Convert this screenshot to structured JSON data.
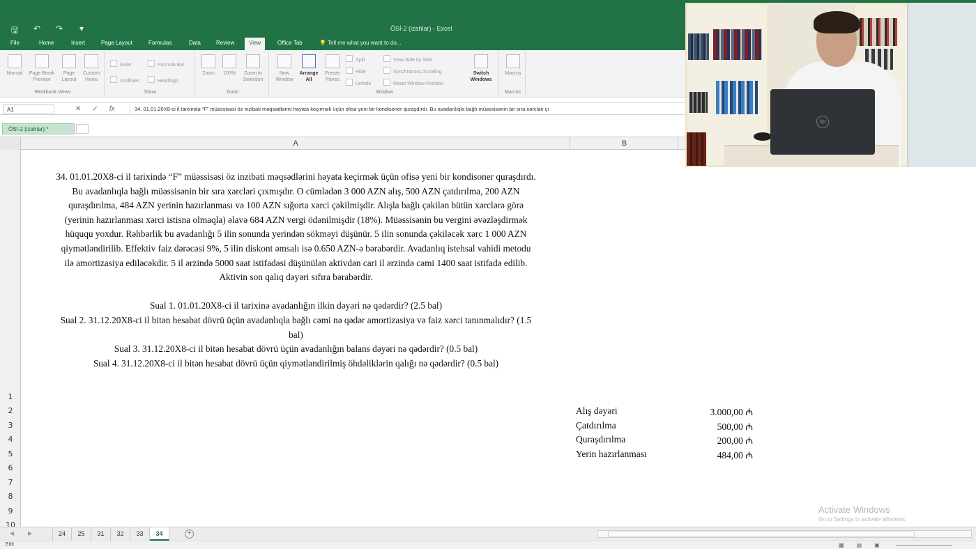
{
  "window": {
    "title": "ÖSİ-2 (izahlar) - Excel",
    "qat": [
      "save",
      "undo",
      "redo",
      "customize"
    ]
  },
  "menu": {
    "items": [
      "File",
      "Home",
      "Insert",
      "Page Layout",
      "Formulas",
      "Data",
      "Review",
      "View",
      "Office Tab"
    ],
    "active": "View",
    "tell_me": "Tell me what you want to do..."
  },
  "ribbon": {
    "workbook_views": {
      "label": "Workbook Views",
      "normal": "Normal",
      "page_break": "Page Break Preview",
      "page_layout": "Page Layout",
      "custom_views": "Custom Views"
    },
    "show": {
      "label": "Show",
      "ruler": "Ruler",
      "formula_bar": "Formula Bar",
      "gridlines": "Gridlines",
      "headings": "Headings"
    },
    "zoom": {
      "label": "Zoom",
      "zoom": "Zoom",
      "hundred": "100%",
      "zoom_sel": "Zoom to Selection"
    },
    "window": {
      "label": "Window",
      "new_window": "New Window",
      "arrange_all": "Arrange All",
      "freeze": "Freeze Panes",
      "split": "Split",
      "hide": "Hide",
      "unhide": "Unhide",
      "side_by_side": "View Side by Side",
      "sync_scroll": "Synchronous Scrolling",
      "reset_pos": "Reset Window Position",
      "switch": "Switch Windows"
    },
    "macros": {
      "label": "Macros",
      "macros": "Macros"
    }
  },
  "formula_bar": {
    "name_box": "A1",
    "formula": "34. 01.01.20X8-ci il tarixində “F” müəssisəsi öz inzibati məqsədlərini həyata keçirmək üçün ofisə yeni bir kondisoner quraşdırdı. Bu avadanlıqla bağlı müəssisənin bir sıra xərcləri çı"
  },
  "doc_tab": {
    "label": "ÖSİ-2 (izahlar) *"
  },
  "columns": {
    "a": "A",
    "b": "B"
  },
  "rows": [
    "1",
    "2",
    "3",
    "4",
    "5",
    "6",
    "7",
    "8",
    "9",
    "10"
  ],
  "question": {
    "lines": [
      "34. 01.01.20X8-ci il tarixində “F” müəssisəsi öz inzibati məqsədlərini həyata keçirmək üçün ofisə yeni bir kondisoner quraşdırdı.",
      "Bu avadanlıqla bağlı müəssisənin bir sıra xərcləri çıxmışdır. O cümlədən 3 000 AZN alış, 500 AZN çatdırılma, 200 AZN",
      "quraşdırılma, 484 AZN yerinin hazırlanması və 100 AZN sığorta xərci çəkilmişdir. Alışla bağlı çəkilən bütün xərclərə görə",
      "(yerinin hazırlanması xərci istisna olmaqla) əlavə 684 AZN vergi ödənilmişdir (18%). Müəssisənin bu vergini əvəzləşdirmək",
      "hüququ yoxdur. Rəhbərlik bu avadanlığı 5 ilin sonunda yerindən sökməyi düşünür. 5 ilin sonunda çəkiləcək xərc 1 000 AZN",
      "qiymətləndirilib. Effektiv faiz dərəcəsi 9%, 5 ilin diskont əmsalı isə 0.650 AZN-ə bərabərdir. Avadanlıq istehsal vahidi metodu",
      "ilə amortizasiya ediləcəkdir. 5 il ərzində 5000 saat istifadəsi düşünülən aktivdən cari il ərzində cəmi 1400 saat istifadə edilib.",
      "Aktivin son qalıq dəyəri sıfıra bərabərdir."
    ],
    "sual1": "Sual 1. 01.01.20X8-ci il tarixinə avadanlığın ilkin dəyəri nə qədərdir? (2.5 bal)",
    "sual2a": "Sual 2. 31.12.20X8-ci il bitən hesabat dövrü üçün avadanlıqla bağlı cəmi nə qədər amortizasiya və faiz xərci tanınmalıdır? (1.5",
    "sual2b": "bal)",
    "sual3": "Sual 3. 31.12.20X8-ci il bitən hesabat dövrü üçün avadanlığın balans dəyəri nə qədərdir? (0.5 bal)",
    "sual4": "Sual 4. 31.12.20X8-ci il bitən hesabat dövrü üçün qiymətləndirilmiş öhdəliklərin qalığı nə qədərdir? (0.5 bal)"
  },
  "cost_table": [
    {
      "label": "Alış dəyəri",
      "value": "3.000,00 ₼"
    },
    {
      "label": "Çatdırılma",
      "value": "500,00 ₼"
    },
    {
      "label": "Quraşdırılma",
      "value": "200,00 ₼"
    },
    {
      "label": "Yerin hazırlanması",
      "value": "484,00 ₼"
    }
  ],
  "sheet_tabs": [
    "24",
    "25",
    "31",
    "32",
    "33",
    "34"
  ],
  "active_sheet": "34",
  "status": {
    "mode": "Edit"
  },
  "watermark": {
    "line1": "Activate Windows",
    "line2": "Go to Settings to activate Windows."
  },
  "colors": {
    "excel_green": "#217346",
    "ribbon_bg": "#f3f3f3",
    "tab_active_text": "#217346"
  }
}
